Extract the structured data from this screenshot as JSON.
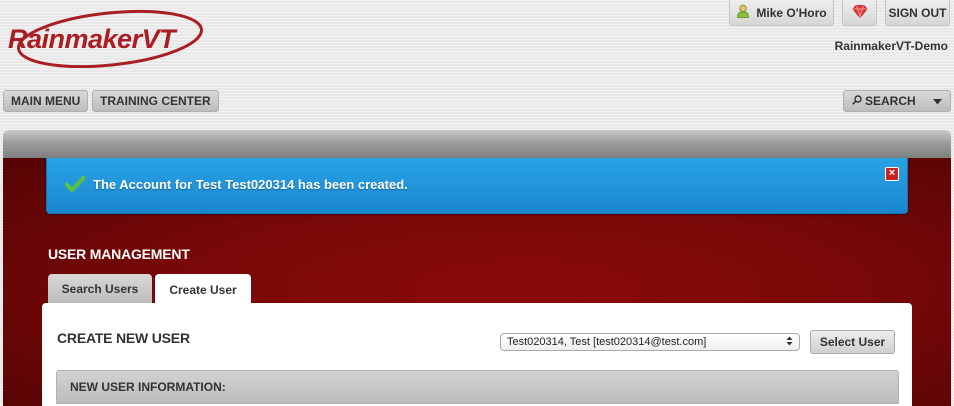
{
  "brand": {
    "logo_part1": "Rainmaker",
    "logo_part2": "VT"
  },
  "topbar": {
    "user_name": "Mike O'Horo",
    "sign_out_label": "SIGN OUT",
    "tenant_name": "RainmakerVT-Demo"
  },
  "nav": {
    "main_menu_label": "MAIN MENU",
    "training_center_label": "TRAINING CENTER",
    "search_label": "SEARCH"
  },
  "alert": {
    "message": "The Account for Test Test020314 has been created.",
    "close_glyph": "×"
  },
  "section": {
    "title": "USER MANAGEMENT"
  },
  "tabs": [
    {
      "label": "Search Users",
      "active": false
    },
    {
      "label": "Create User",
      "active": true
    }
  ],
  "create_user": {
    "title": "CREATE NEW USER",
    "selected_user": "Test020314, Test [test020314@test.com]",
    "select_button_label": "Select User",
    "info_header": "NEW USER INFORMATION:"
  },
  "colors": {
    "brand_red": "#a81e22",
    "panel_red": "#7a0808",
    "alert_blue": "#1f93dc",
    "check_green": "#5cc23c"
  },
  "icons": [
    "user-icon",
    "gem-icon",
    "search-icon",
    "chevron-down-icon",
    "check-icon",
    "close-icon",
    "select-arrows-icon"
  ]
}
